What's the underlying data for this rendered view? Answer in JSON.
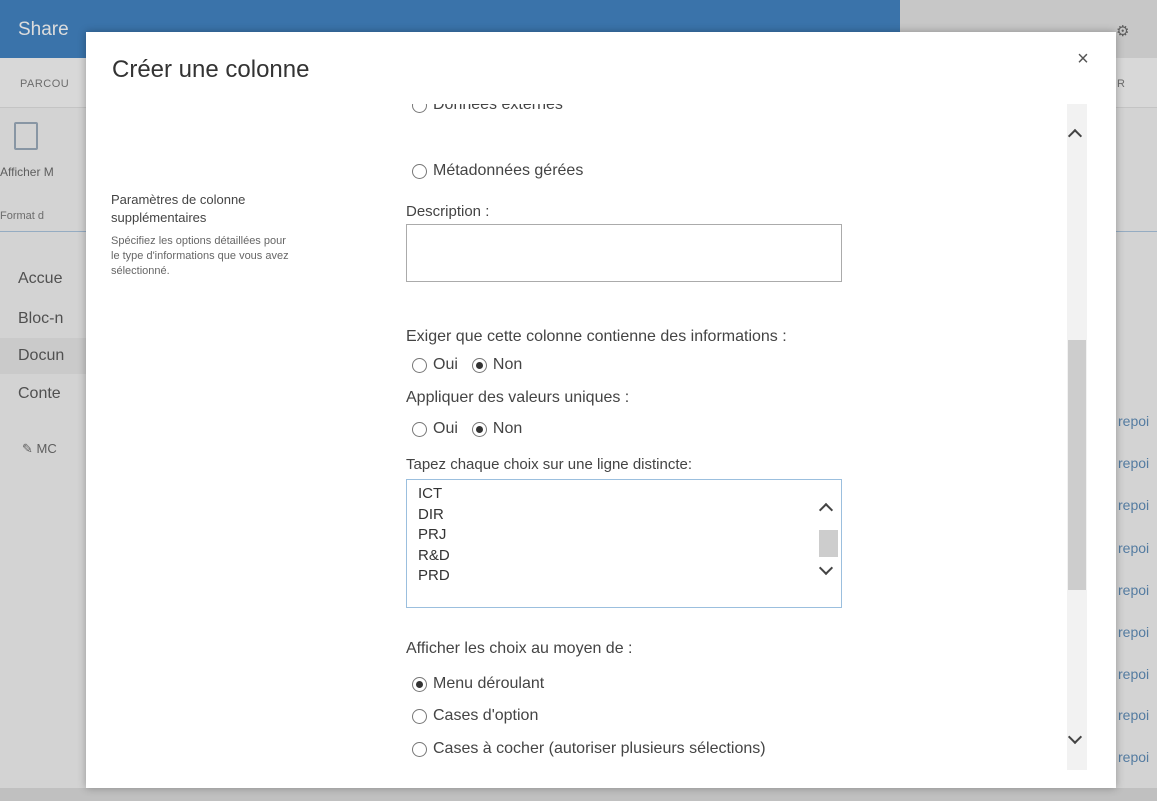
{
  "background": {
    "brand": "Share",
    "ribbon_tab": "PARCOU",
    "ribbon_right": "R",
    "view_label": "Afficher M",
    "format_label": "Format d",
    "nav": [
      "Accue",
      "Bloc-n",
      "Docun",
      "Conte"
    ],
    "edit_label": "MC",
    "list_cells": [
      "repoi",
      "repoi",
      "repoi",
      "repoi",
      "repoi",
      "repoi",
      "repoi",
      "repoi",
      "repoi"
    ]
  },
  "dialog": {
    "title": "Créer une colonne",
    "close_label": "×",
    "top_options": [
      "Données externes",
      "Métadonnées gérées"
    ],
    "section": {
      "title": "Paramètres de colonne supplémentaires",
      "description": "Spécifiez les options détaillées pour le type d'informations que vous avez sélectionné."
    },
    "description_label": "Description :",
    "description_value": "",
    "required": {
      "label": "Exiger que cette colonne contienne des informations :",
      "options": [
        "Oui",
        "Non"
      ],
      "selected": "Non"
    },
    "unique": {
      "label": "Appliquer des valeurs uniques :",
      "options": [
        "Oui",
        "Non"
      ],
      "selected": "Non"
    },
    "choices": {
      "label": "Tapez chaque choix sur une ligne distincte:",
      "items": [
        "ICT",
        "DIR",
        "PRJ",
        "R&D",
        "PRD"
      ]
    },
    "display": {
      "label": "Afficher les choix au moyen de :",
      "options": [
        "Menu déroulant",
        "Cases d'option",
        "Cases à cocher (autoriser plusieurs sélections)"
      ],
      "selected": "Menu déroulant"
    }
  }
}
